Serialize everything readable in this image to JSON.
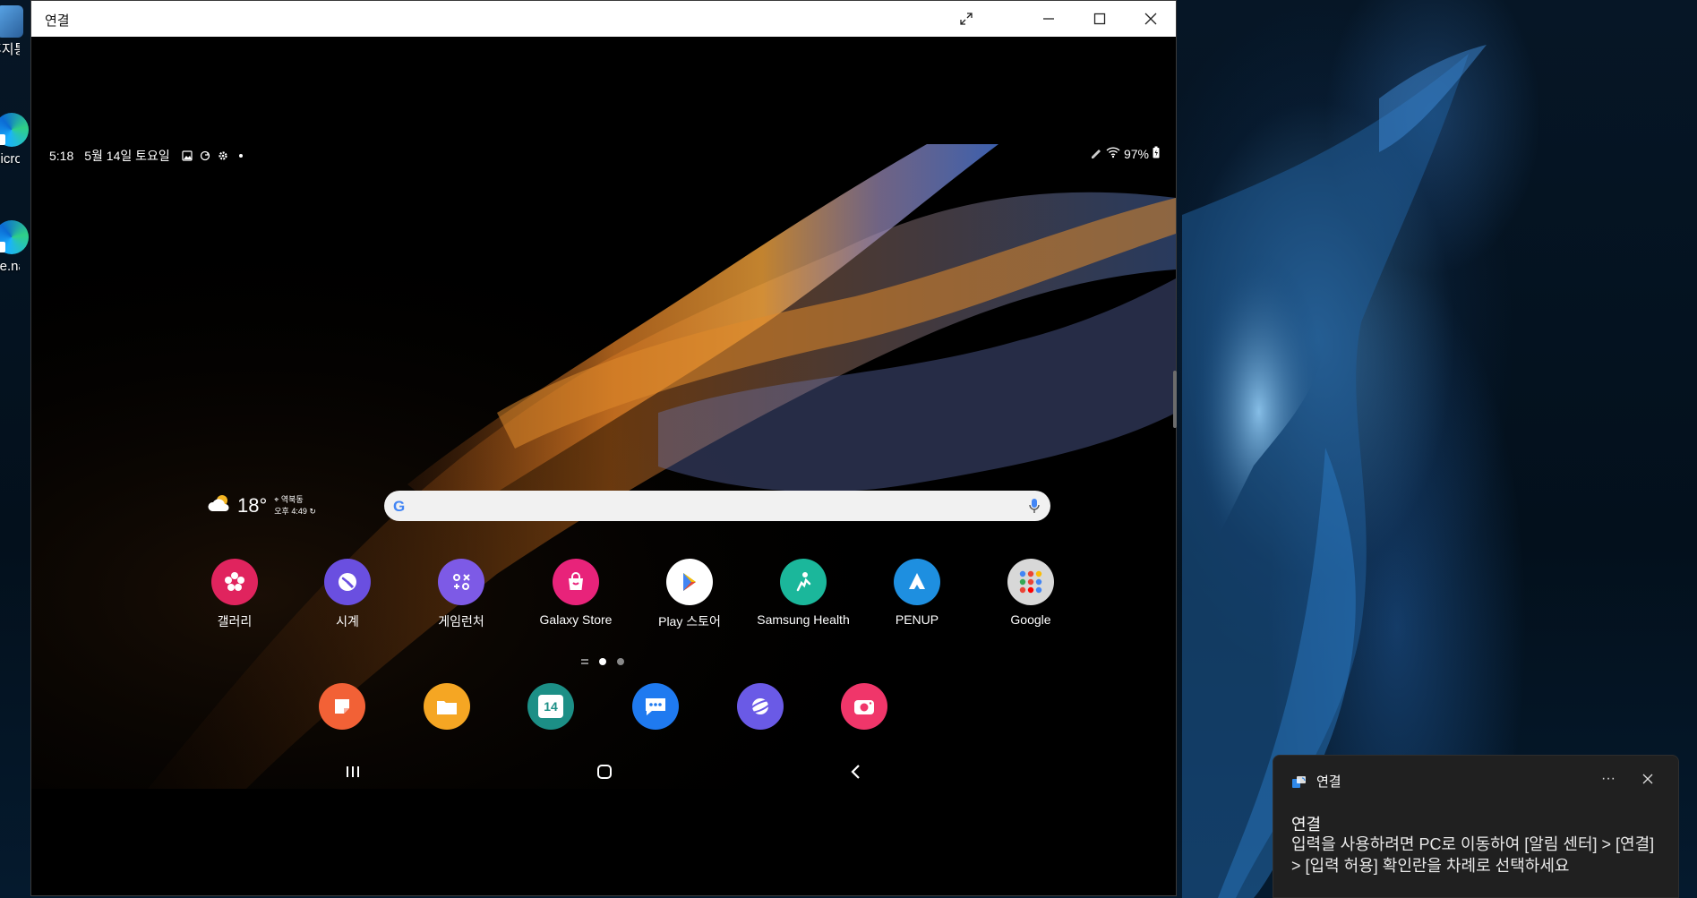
{
  "desktop": {
    "icons": [
      {
        "label": "휴지통"
      },
      {
        "label": "Microsoft Edge"
      },
      {
        "label": "ale.na"
      }
    ]
  },
  "window": {
    "title": "연결"
  },
  "phone": {
    "status": {
      "time": "5:18",
      "date": "5월 14일 토요일",
      "battery": "97%"
    },
    "weather": {
      "temp": "18°",
      "location": "역북동",
      "updated": "오후 4:49"
    },
    "apps": [
      {
        "label": "갤러리",
        "icon": "gallery-icon",
        "color": "#e0245e"
      },
      {
        "label": "시계",
        "icon": "clock-icon",
        "color": "#6a4fe0"
      },
      {
        "label": "게임런처",
        "icon": "game-launcher-icon",
        "color": "#7d5ae6"
      },
      {
        "label": "Galaxy Store",
        "icon": "galaxy-store-icon",
        "color": "#e8237a"
      },
      {
        "label": "Play 스토어",
        "icon": "play-store-icon",
        "color": "#ffffff"
      },
      {
        "label": "Samsung Health",
        "icon": "samsung-health-icon",
        "color": "#1bb79b"
      },
      {
        "label": "PENUP",
        "icon": "penup-icon",
        "color": "#1e8fe0"
      },
      {
        "label": "Google",
        "icon": "google-folder-icon",
        "color": "#d8d8d8"
      }
    ],
    "dock": [
      {
        "icon": "notes-icon",
        "color": "#f26136"
      },
      {
        "icon": "my-files-icon",
        "color": "#f5a623"
      },
      {
        "icon": "calendar-icon",
        "color": "#1c8f86",
        "label": "14"
      },
      {
        "icon": "messages-icon",
        "color": "#1f7af0"
      },
      {
        "icon": "internet-icon",
        "color": "#6a5ae6"
      },
      {
        "icon": "camera-icon",
        "color": "#f0366a"
      }
    ]
  },
  "notification": {
    "app_name": "연결",
    "more_label": "···",
    "title": "연결",
    "body": "입력을 사용하려면 PC로 이동하여 [알림 센터] > [연결] > [입력 허용] 확인란을 차례로 선택하세요"
  }
}
